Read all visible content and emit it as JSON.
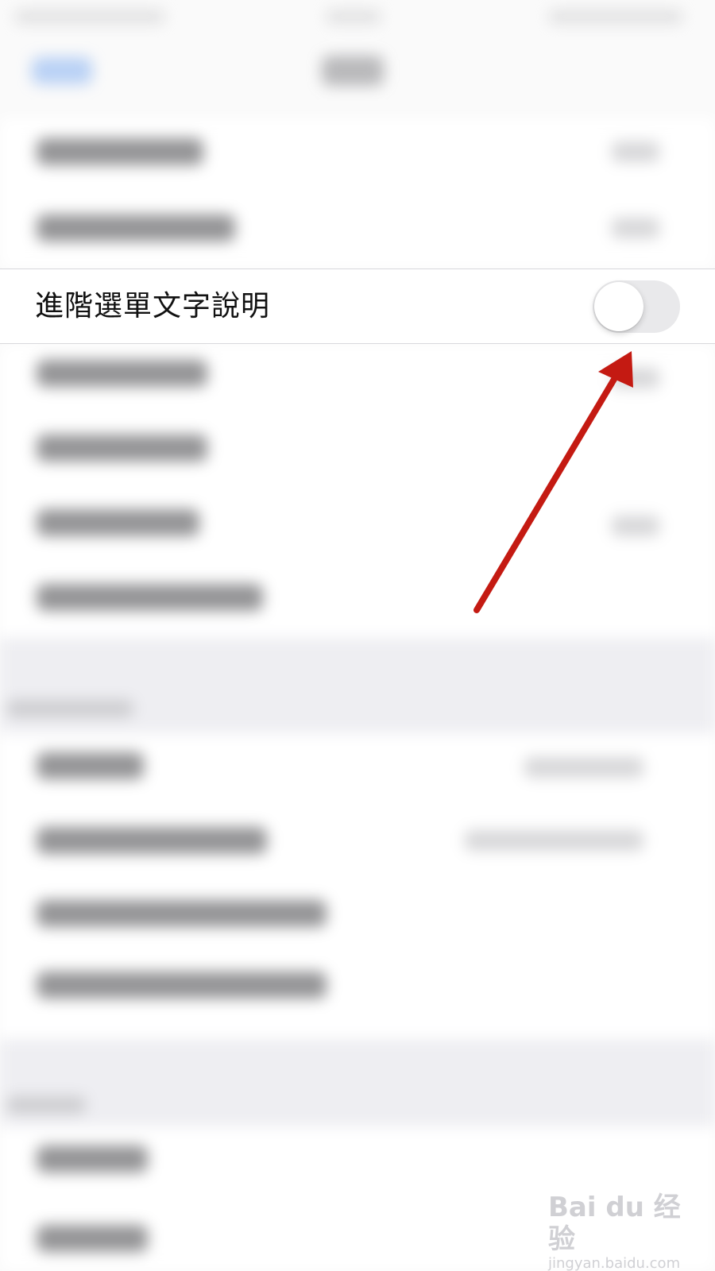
{
  "focused_row": {
    "label": "進階選單文字說明",
    "toggle_on": false
  },
  "colors": {
    "toggle_off_track": "#e9e9eb",
    "annotation_arrow": "#c41a12",
    "group_background": "#ffffff",
    "grouped_gap_background": "#eeeef2"
  },
  "watermark": {
    "logo": "Bai du 经验",
    "url": "jingyan.baidu.com"
  }
}
